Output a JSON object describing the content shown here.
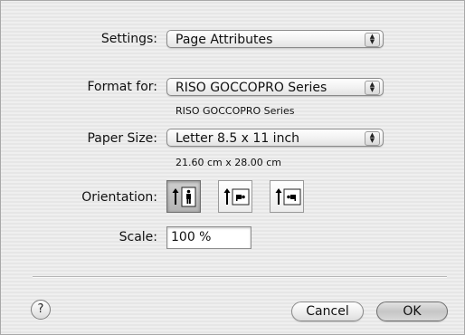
{
  "settings": {
    "label": "Settings:",
    "value": "Page Attributes"
  },
  "format": {
    "label": "Format for:",
    "value": "RISO GOCCOPRO Series",
    "subtext": "RISO GOCCOPRO Series"
  },
  "paper": {
    "label": "Paper Size:",
    "value": "Letter 8.5 x 11 inch",
    "subtext": "21.60 cm x 28.00 cm"
  },
  "orientation": {
    "label": "Orientation:",
    "options": [
      "portrait",
      "landscape-left",
      "landscape-right"
    ],
    "selected": "portrait"
  },
  "scale": {
    "label": "Scale:",
    "value": "100 %"
  },
  "help": {
    "glyph": "?"
  },
  "buttons": {
    "cancel": "Cancel",
    "ok": "OK"
  },
  "icons": {
    "popup_arrows": "popup-arrows-icon",
    "orientation_portrait": "portrait-orientation-icon",
    "orientation_landscape_left": "landscape-left-orientation-icon",
    "orientation_landscape_right": "landscape-right-orientation-icon"
  }
}
